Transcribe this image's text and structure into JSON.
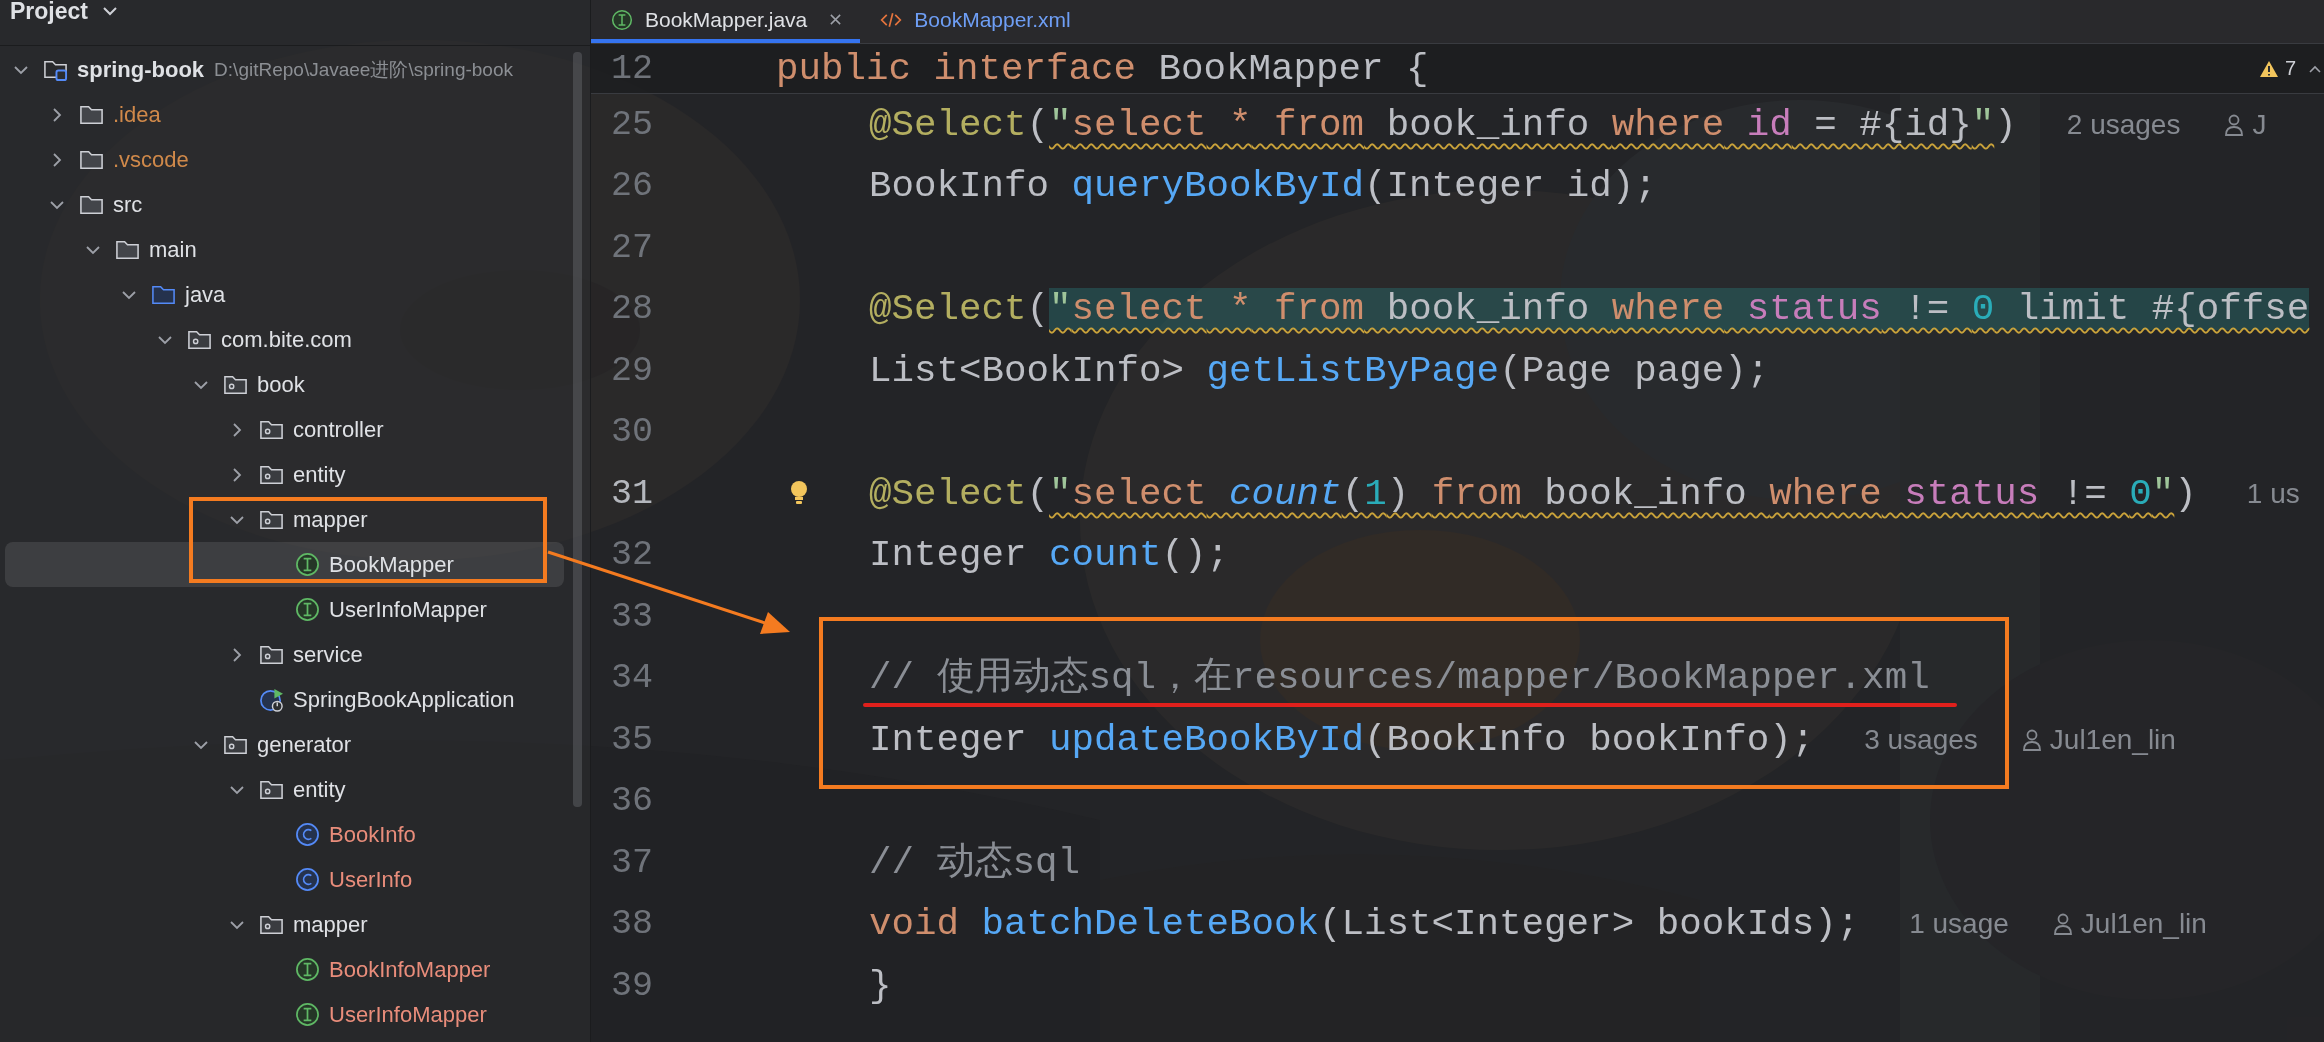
{
  "sidebar": {
    "title": "Project",
    "tree": [
      {
        "label": "spring-book",
        "kind": "module",
        "path": "D:\\gitRepo\\Javaee进阶\\spring-book",
        "expanded": true,
        "selected": false,
        "color": "#dfe1e5",
        "children": [
          {
            "label": ".idea",
            "kind": "folder",
            "expanded": false,
            "selected": false,
            "color": "#d0894a"
          },
          {
            "label": ".vscode",
            "kind": "folder",
            "expanded": false,
            "selected": false,
            "color": "#d0894a"
          },
          {
            "label": "src",
            "kind": "folder",
            "expanded": true,
            "selected": false,
            "color": "#dfe1e5",
            "children": [
              {
                "label": "main",
                "kind": "folder",
                "expanded": true,
                "selected": false,
                "color": "#dfe1e5",
                "children": [
                  {
                    "label": "java",
                    "kind": "source_root",
                    "expanded": true,
                    "selected": false,
                    "color": "#dfe1e5",
                    "children": [
                      {
                        "label": "com.bite.com",
                        "kind": "package",
                        "expanded": true,
                        "selected": false,
                        "color": "#dfe1e5",
                        "children": [
                          {
                            "label": "book",
                            "kind": "package",
                            "expanded": true,
                            "selected": false,
                            "color": "#dfe1e5",
                            "children": [
                              {
                                "label": "controller",
                                "kind": "package",
                                "expanded": false,
                                "selected": false,
                                "color": "#dfe1e5"
                              },
                              {
                                "label": "entity",
                                "kind": "package",
                                "expanded": false,
                                "selected": false,
                                "color": "#dfe1e5"
                              },
                              {
                                "label": "mapper",
                                "kind": "package",
                                "expanded": true,
                                "selected": false,
                                "color": "#dfe1e5",
                                "children": [
                                  {
                                    "label": "BookMapper",
                                    "kind": "interface",
                                    "selected": true,
                                    "color": "#dfe1e5"
                                  },
                                  {
                                    "label": "UserInfoMapper",
                                    "kind": "interface",
                                    "selected": false,
                                    "color": "#dfe1e5"
                                  }
                                ]
                              },
                              {
                                "label": "service",
                                "kind": "package",
                                "expanded": false,
                                "selected": false,
                                "color": "#dfe1e5"
                              },
                              {
                                "label": "SpringBookApplication",
                                "kind": "app",
                                "selected": false,
                                "color": "#dfe1e5"
                              }
                            ]
                          },
                          {
                            "label": "generator",
                            "kind": "package",
                            "expanded": true,
                            "selected": false,
                            "color": "#dfe1e5",
                            "children": [
                              {
                                "label": "entity",
                                "kind": "package",
                                "expanded": true,
                                "selected": false,
                                "color": "#dfe1e5",
                                "children": [
                                  {
                                    "label": "BookInfo",
                                    "kind": "class",
                                    "selected": false,
                                    "color": "#e98d7b"
                                  },
                                  {
                                    "label": "UserInfo",
                                    "kind": "class",
                                    "selected": false,
                                    "color": "#e98d7b"
                                  }
                                ]
                              },
                              {
                                "label": "mapper",
                                "kind": "package",
                                "expanded": true,
                                "selected": false,
                                "color": "#dfe1e5",
                                "children": [
                                  {
                                    "label": "BookInfoMapper",
                                    "kind": "interface",
                                    "selected": false,
                                    "color": "#e98d7b"
                                  },
                                  {
                                    "label": "UserInfoMapper",
                                    "kind": "interface",
                                    "selected": false,
                                    "color": "#e98d7b"
                                  }
                                ]
                              }
                            ]
                          }
                        ]
                      }
                    ]
                  }
                ]
              }
            ]
          }
        ]
      }
    ]
  },
  "tabs": [
    {
      "label": "BookMapper.java",
      "kind": "interface",
      "selected": true,
      "color": "#dfe1e5"
    },
    {
      "label": "BookMapper.xml",
      "kind": "xml",
      "selected": false,
      "color": "#6e9ef5"
    }
  ],
  "editor": {
    "warnings": "7",
    "sticky": {
      "number": "12",
      "code": [
        {
          "text": "public",
          "kind": "keyword"
        },
        {
          "text": " interface",
          "kind": "keyword"
        },
        {
          "text": " BookMapper {",
          "kind": "plain"
        }
      ]
    },
    "lines": [
      {
        "number": "25",
        "current": false,
        "bulb": false,
        "code": [
          {
            "text": "@Select",
            "kind": "annotation"
          },
          {
            "text": "(",
            "kind": "plain"
          }
        ],
        "sql": {
          "highlighted": false,
          "tokens": [
            {
              "text": "\"",
              "kind": "string"
            },
            {
              "text": "select",
              "kind": "keyword"
            },
            {
              "text": " *",
              "kind": "keyword"
            },
            {
              "text": " from",
              "kind": "keyword"
            },
            {
              "text": " book_info ",
              "kind": "plain"
            },
            {
              "text": "where",
              "kind": "keyword"
            },
            {
              "text": " id",
              "kind": "column"
            },
            {
              "text": " = #{id}",
              "kind": "plain"
            },
            {
              "text": "\"",
              "kind": "string"
            }
          ]
        },
        "tail": [
          {
            "text": ")",
            "kind": "plain"
          }
        ],
        "usages": "2 usages",
        "author": "J"
      },
      {
        "number": "26",
        "current": false,
        "bulb": false,
        "code": [
          {
            "text": "BookInfo ",
            "kind": "plain"
          },
          {
            "text": "queryBookById",
            "kind": "method"
          },
          {
            "text": "(Integer id);",
            "kind": "plain"
          }
        ]
      },
      {
        "number": "27",
        "current": false,
        "bulb": false
      },
      {
        "number": "28",
        "current": false,
        "bulb": false,
        "code": [
          {
            "text": "@Select",
            "kind": "annotation"
          },
          {
            "text": "(",
            "kind": "plain"
          }
        ],
        "sql": {
          "highlighted": true,
          "tokens": [
            {
              "text": "\"",
              "kind": "string"
            },
            {
              "text": "select",
              "kind": "keyword"
            },
            {
              "text": " *",
              "kind": "keyword"
            },
            {
              "text": " from",
              "kind": "keyword"
            },
            {
              "text": " book_info ",
              "kind": "plain"
            },
            {
              "text": "where",
              "kind": "keyword"
            },
            {
              "text": " status",
              "kind": "column"
            },
            {
              "text": " != ",
              "kind": "plain"
            },
            {
              "text": "0",
              "kind": "number"
            },
            {
              "text": " limit #{offse",
              "kind": "plain"
            }
          ]
        }
      },
      {
        "number": "29",
        "current": false,
        "bulb": false,
        "code": [
          {
            "text": "List<BookInfo> ",
            "kind": "plain"
          },
          {
            "text": "getListByPage",
            "kind": "method"
          },
          {
            "text": "(Page page);",
            "kind": "plain"
          }
        ]
      },
      {
        "number": "30",
        "current": false,
        "bulb": false
      },
      {
        "number": "31",
        "current": true,
        "bulb": true,
        "code": [
          {
            "text": "@Select",
            "kind": "annotation"
          },
          {
            "text": "(",
            "kind": "plain"
          }
        ],
        "sql": {
          "highlighted": false,
          "tokens": [
            {
              "text": "\"",
              "kind": "string"
            },
            {
              "text": "select",
              "kind": "keyword"
            },
            {
              "text": " count",
              "kind": "call"
            },
            {
              "text": "(",
              "kind": "plain"
            },
            {
              "text": "1",
              "kind": "number"
            },
            {
              "text": ") ",
              "kind": "plain"
            },
            {
              "text": "from",
              "kind": "keyword"
            },
            {
              "text": " book_info ",
              "kind": "plain"
            },
            {
              "text": "where",
              "kind": "keyword"
            },
            {
              "text": " status",
              "kind": "column"
            },
            {
              "text": " != ",
              "kind": "plain"
            },
            {
              "text": "0",
              "kind": "number"
            },
            {
              "text": "\"",
              "kind": "string"
            }
          ]
        },
        "tail": [
          {
            "text": ")",
            "kind": "plain"
          }
        ],
        "usages": "1 us"
      },
      {
        "number": "32",
        "current": false,
        "bulb": false,
        "code": [
          {
            "text": "Integer ",
            "kind": "plain"
          },
          {
            "text": "count",
            "kind": "method"
          },
          {
            "text": "();",
            "kind": "plain"
          }
        ]
      },
      {
        "number": "33",
        "current": false,
        "bulb": false
      },
      {
        "number": "34",
        "current": false,
        "bulb": false,
        "code": [
          {
            "text": "// 使用动态sql，在resources/mapper/BookMapper.xml",
            "kind": "comment"
          }
        ]
      },
      {
        "number": "35",
        "current": false,
        "bulb": false,
        "code": [
          {
            "text": "Integer ",
            "kind": "plain"
          },
          {
            "text": "updateBookById",
            "kind": "method"
          },
          {
            "text": "(BookInfo bookInfo);",
            "kind": "plain"
          }
        ],
        "usages": "3 usages",
        "author": "Jul1en_lin"
      },
      {
        "number": "36",
        "current": false,
        "bulb": false
      },
      {
        "number": "37",
        "current": false,
        "bulb": false,
        "code": [
          {
            "text": "// 动态sql",
            "kind": "comment"
          }
        ]
      },
      {
        "number": "38",
        "current": false,
        "bulb": false,
        "code": [
          {
            "text": "void",
            "kind": "keyword"
          },
          {
            "text": " batchDeleteBook",
            "kind": "method"
          },
          {
            "text": "(List<Integer> bookIds);",
            "kind": "plain"
          }
        ],
        "usages": "1 usage",
        "author": "Jul1en_lin"
      },
      {
        "number": "39",
        "current": false,
        "bulb": false,
        "code": [
          {
            "text": "}",
            "kind": "plain"
          }
        ]
      }
    ]
  }
}
